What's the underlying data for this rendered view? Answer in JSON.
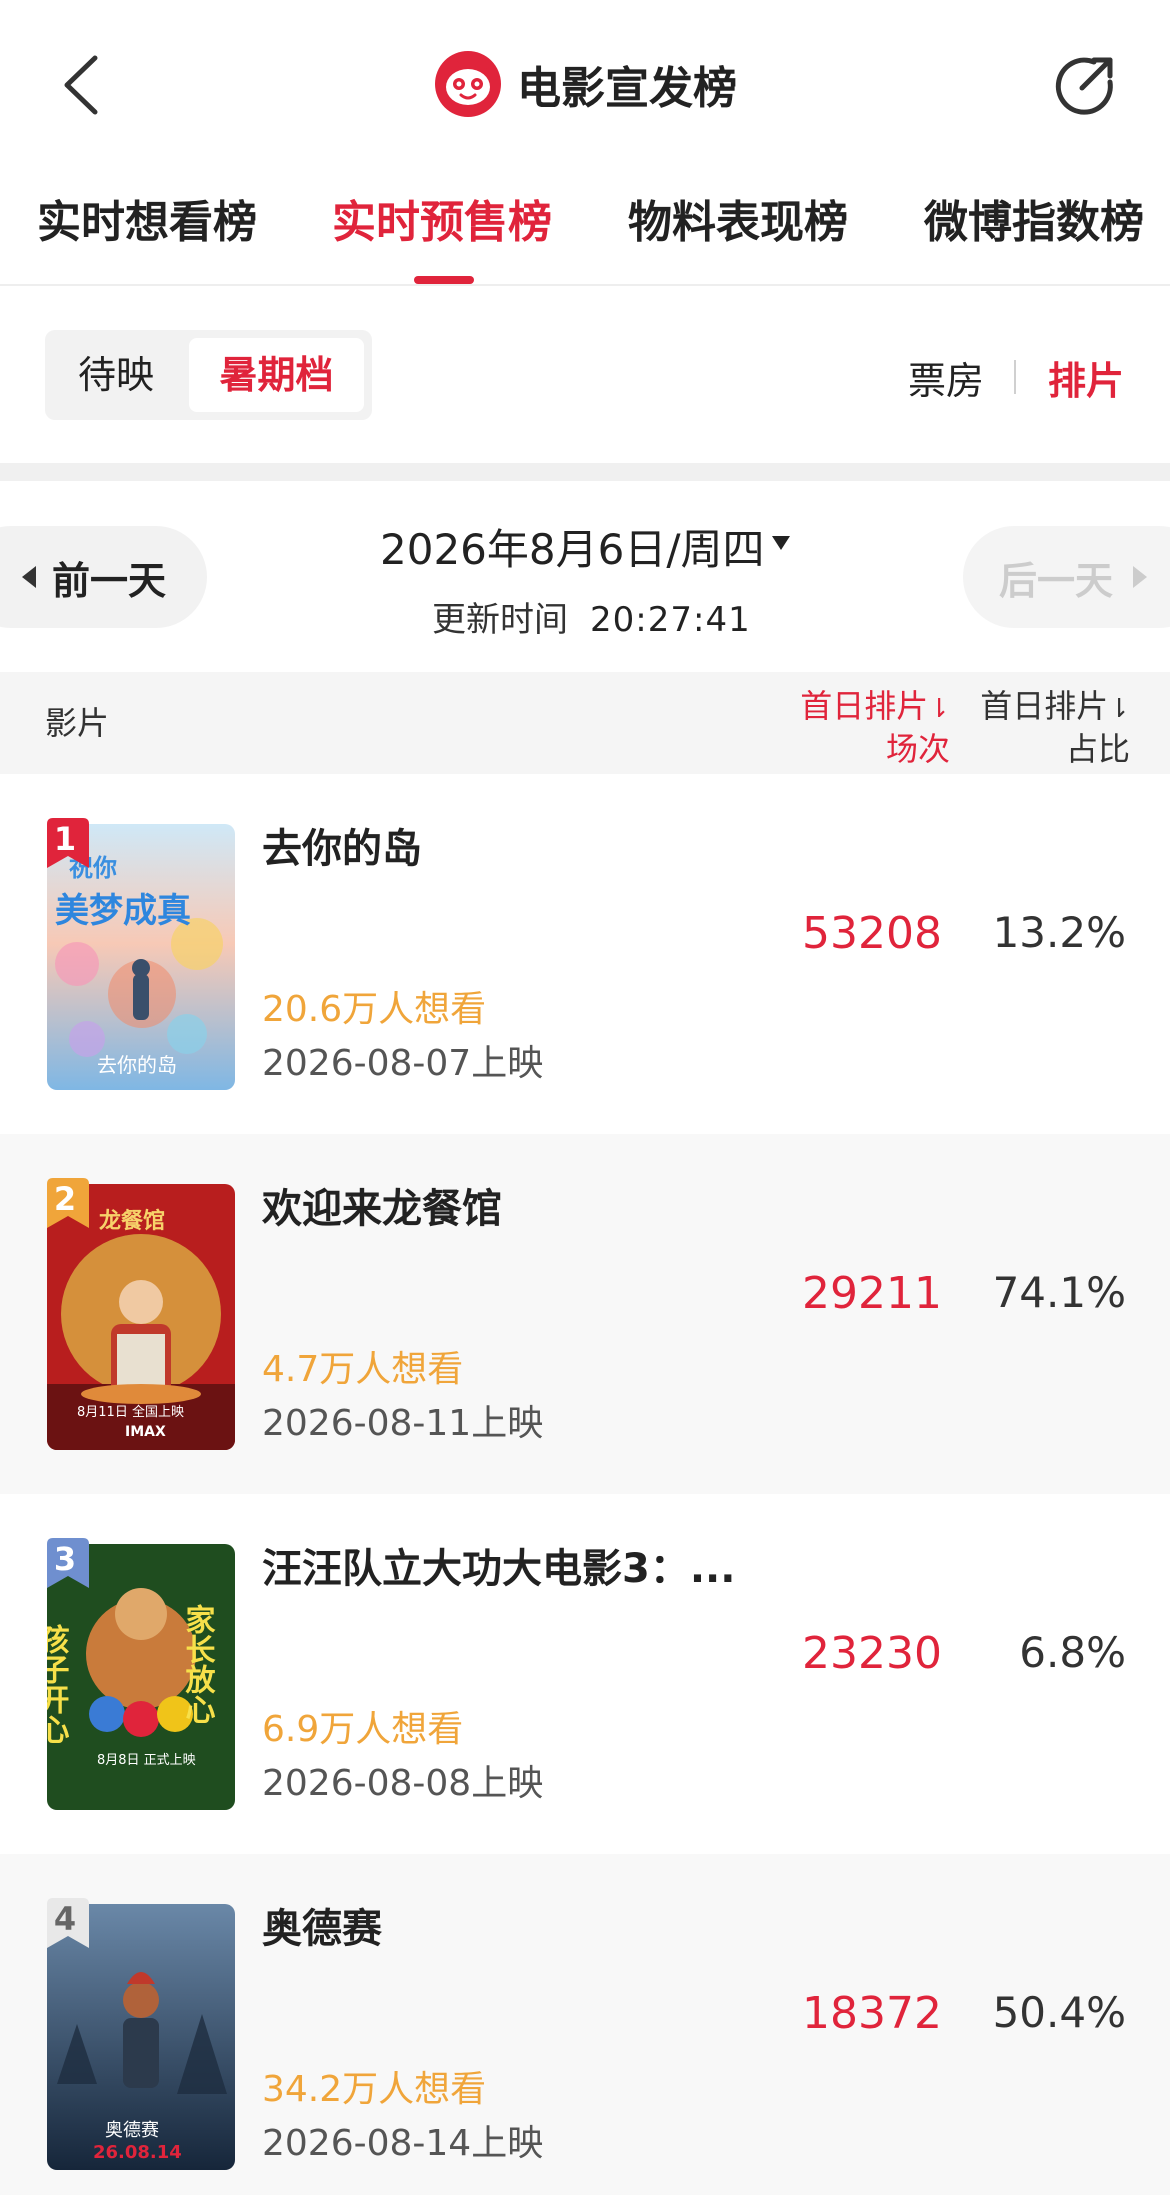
{
  "header": {
    "title": "电影宣发榜",
    "back_icon": "chevron-left-icon",
    "share_icon": "share-icon",
    "logo_icon": "cat-logo-icon",
    "brand_color": "#e0243b"
  },
  "tabs": [
    {
      "label": "实时想看榜",
      "active": false
    },
    {
      "label": "实时预售榜",
      "active": true
    },
    {
      "label": "物料表现榜",
      "active": false
    },
    {
      "label": "微博指数榜",
      "active": false
    }
  ],
  "filter": {
    "segments": [
      {
        "label": "待映",
        "active": false
      },
      {
        "label": "暑期档",
        "active": true
      }
    ],
    "metric_a": "票房",
    "metric_b": "排片",
    "metric_active": "排片"
  },
  "date_nav": {
    "prev_label": "前一天",
    "next_label": "后一天",
    "date": "2026年8月6日/周四",
    "update_label": "更新时间",
    "update_time": "20:27:41"
  },
  "table": {
    "col_film": "影片",
    "col_shows_line1": "首日排片",
    "col_shows_line2": "场次",
    "col_ratio_line1": "首日排片",
    "col_ratio_line2": "占比",
    "rows": [
      {
        "rank": "1",
        "title": "去你的岛",
        "want": "20.6万人想看",
        "release": "2026-08-07上映",
        "shows": "53208",
        "ratio": "13.2%"
      },
      {
        "rank": "2",
        "title": "欢迎来龙餐馆",
        "want": "4.7万人想看",
        "release": "2026-08-11上映",
        "shows": "29211",
        "ratio": "74.1%"
      },
      {
        "rank": "3",
        "title": "汪汪队立大功大电影3：...",
        "want": "6.9万人想看",
        "release": "2026-08-08上映",
        "shows": "23230",
        "ratio": "6.8%"
      },
      {
        "rank": "4",
        "title": "奥德赛",
        "want": "34.2万人想看",
        "release": "2026-08-14上映",
        "shows": "18372",
        "ratio": "50.4%"
      }
    ]
  },
  "posters": [
    {
      "text_top": "祝你",
      "text_main": "美梦成真",
      "text_bottom": "去你的岛"
    },
    {
      "text_top": "龙餐馆",
      "text_bottom": "8月11日 全国上映",
      "text_badge": "IMAX"
    },
    {
      "text_left": "孩子开心",
      "text_right": "家长放心",
      "text_bottom": "8月8日 正式上映"
    },
    {
      "text_main": "奥德赛",
      "text_bottom": "26.08.14"
    }
  ]
}
